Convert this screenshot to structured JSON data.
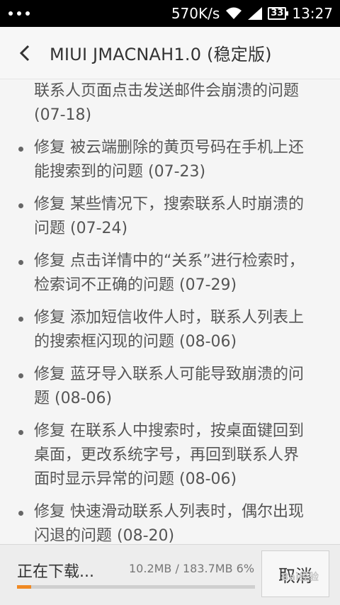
{
  "status_bar": {
    "speed": "570K/s",
    "battery": "33",
    "time": "13:27"
  },
  "header": {
    "title": "MIUI JMACNAH1.0 (稳定版)"
  },
  "changelog": [
    {
      "lines": [
        "联系人页面点击发送邮件会崩溃的问题",
        "(07-18)"
      ],
      "bullet": false
    },
    {
      "lines": [
        "修复 被云端删除的黄页号码在手机上还",
        "能搜索到的问题 (07-23)"
      ],
      "bullet": true
    },
    {
      "lines": [
        "修复 某些情况下，搜索联系人时崩溃的",
        "问题 (07-24)"
      ],
      "bullet": true
    },
    {
      "lines": [
        "修复 点击详情中的“关系”进行检索时，",
        "检索词不正确的问题 (07-29)"
      ],
      "bullet": true
    },
    {
      "lines": [
        "修复 添加短信收件人时，联系人列表上",
        "的搜索框闪现的问题 (08-06)"
      ],
      "bullet": true
    },
    {
      "lines": [
        "修复 蓝牙导入联系人可能导致崩溃的问",
        "题 (08-06)"
      ],
      "bullet": true
    },
    {
      "lines": [
        "修复 在联系人中搜索时，按桌面键回到",
        "桌面，更改系统字号，再回到联系人界",
        "面时显示异常的问题 (08-06)"
      ],
      "bullet": true
    },
    {
      "lines": [
        "修复 快速滑动联系人列表时，偶尔出现",
        "闪退的问题 (08-20)"
      ],
      "bullet": true
    }
  ],
  "download": {
    "label": "正在下载...",
    "info": "10.2MB / 183.7MB  6%",
    "progress": 0.06,
    "cancel_label": "取消",
    "accent": "#f08a24"
  },
  "watermark": "Bai经验"
}
